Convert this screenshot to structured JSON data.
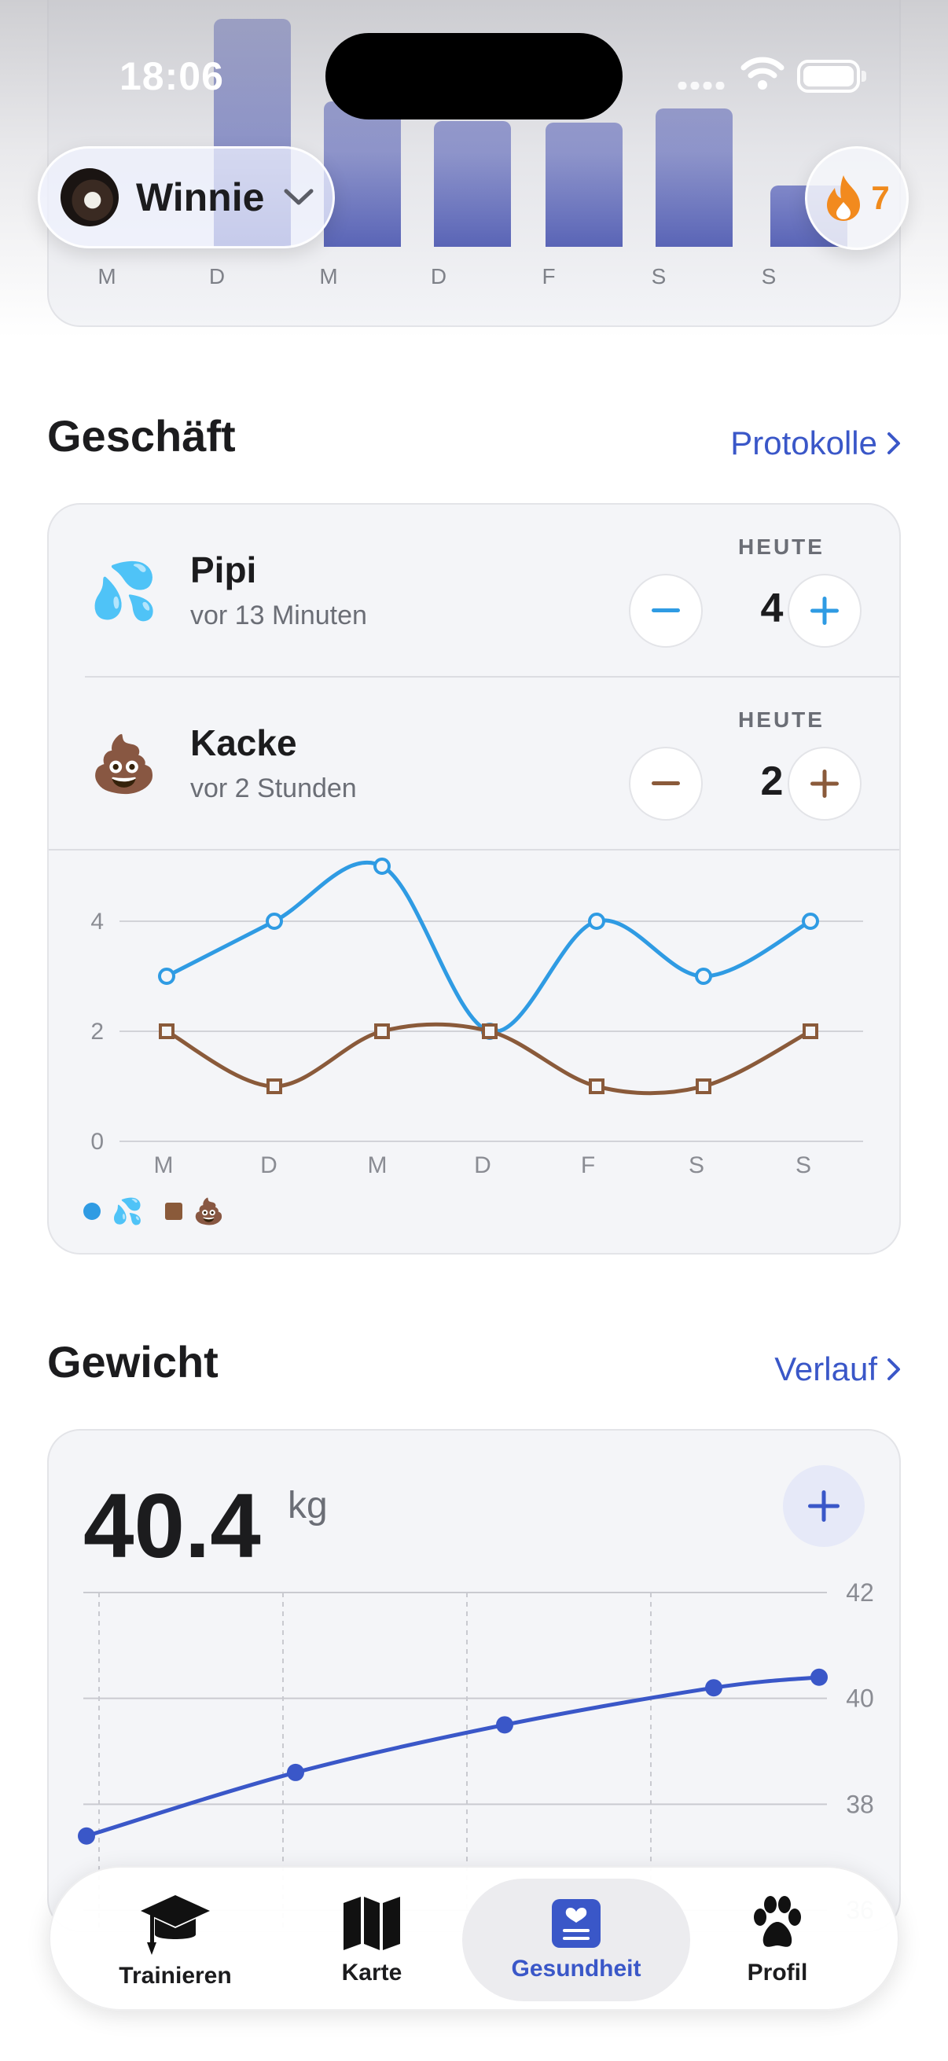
{
  "status_bar": {
    "time": "18:06"
  },
  "top_activity": {
    "days": [
      "M",
      "D",
      "M",
      "D",
      "F",
      "S",
      "S"
    ]
  },
  "dog_selector": {
    "name": "Winnie"
  },
  "streak": {
    "count": "7"
  },
  "geschaeft": {
    "title": "Geschäft",
    "link_label": "Protokolle",
    "rows": [
      {
        "name": "Pipi",
        "emoji": "💦",
        "last": "vor 13 Minuten",
        "today_label": "HEUTE",
        "count": "4",
        "color": "#2f9be3"
      },
      {
        "name": "Kacke",
        "emoji": "💩",
        "last": "vor 2 Stunden",
        "today_label": "HEUTE",
        "count": "2",
        "color": "#8a5a3a"
      }
    ],
    "legend": [
      {
        "emoji": "💦"
      },
      {
        "emoji": "💩"
      }
    ]
  },
  "chart_data": [
    {
      "type": "line",
      "categories": [
        "M",
        "D",
        "M",
        "D",
        "F",
        "S",
        "S"
      ],
      "ylim": [
        0,
        5
      ],
      "yticks": [
        "0",
        "2",
        "4"
      ],
      "series": [
        {
          "values": [
            3,
            4,
            5,
            2,
            4,
            3,
            4
          ],
          "color": "#2f9be3"
        },
        {
          "values": [
            2,
            1,
            2,
            2,
            1,
            1,
            2
          ],
          "color": "#8a5a3a"
        }
      ]
    },
    {
      "type": "line",
      "yticks": [
        "42",
        "40",
        "38",
        "36"
      ],
      "ylim": [
        36,
        42
      ],
      "series": [
        {
          "values": [
            37.4,
            38.6,
            39.5,
            40.2,
            40.4
          ],
          "color": "#3a57c8"
        }
      ]
    }
  ],
  "gewicht": {
    "title": "Gewicht",
    "link_label": "Verlauf",
    "value": "40.4",
    "unit": "kg"
  },
  "tabbar": {
    "tabs": [
      {
        "label": "Trainieren",
        "icon": "graduation-cap-icon"
      },
      {
        "label": "Karte",
        "icon": "map-icon"
      },
      {
        "label": "Gesundheit",
        "icon": "health-icon"
      },
      {
        "label": "Profil",
        "icon": "paw-icon"
      }
    ],
    "accent": "#3a57c8"
  }
}
